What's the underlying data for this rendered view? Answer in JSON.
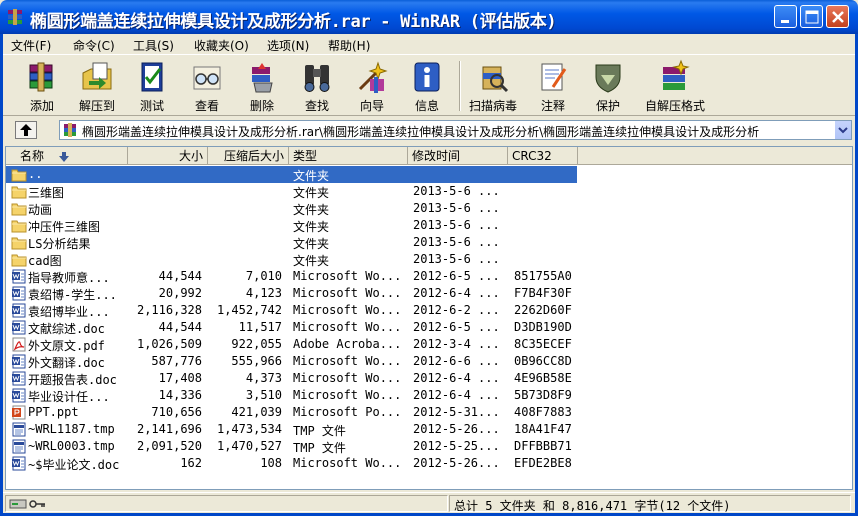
{
  "window": {
    "title": "椭圆形端盖连续拉伸模具设计及成形分析.rar - WinRAR (评估版本)"
  },
  "menu": [
    {
      "label": "文件(F)"
    },
    {
      "label": "命令(C)"
    },
    {
      "label": "工具(S)"
    },
    {
      "label": "收藏夹(O)"
    },
    {
      "label": "选项(N)"
    },
    {
      "label": "帮助(H)"
    }
  ],
  "toolbar": [
    {
      "label": "添加",
      "icon": "add-books-icon"
    },
    {
      "label": "解压到",
      "icon": "extract-to-icon"
    },
    {
      "label": "测试",
      "icon": "test-icon"
    },
    {
      "label": "查看",
      "icon": "view-glasses-icon"
    },
    {
      "label": "删除",
      "icon": "delete-icon"
    },
    {
      "label": "查找",
      "icon": "find-binoculars-icon"
    },
    {
      "label": "向导",
      "icon": "wizard-icon"
    },
    {
      "label": "信息",
      "icon": "info-icon"
    },
    {
      "label": "扫描病毒",
      "icon": "virus-scan-icon"
    },
    {
      "label": "注释",
      "icon": "comment-icon"
    },
    {
      "label": "保护",
      "icon": "protect-shield-icon"
    },
    {
      "label": "自解压格式",
      "icon": "sfx-icon"
    }
  ],
  "address": {
    "path": "椭圆形端盖连续拉伸模具设计及成形分析.rar\\椭圆形端盖连续拉伸模具设计及成形分析\\椭圆形端盖连续拉伸模具设计及成形分析"
  },
  "columns": {
    "name": "名称",
    "size": "大小",
    "packed": "压缩后大小",
    "type": "类型",
    "modified": "修改时间",
    "crc": "CRC32"
  },
  "files": [
    {
      "name": "..",
      "size": "",
      "packed": "",
      "type": "文件夹",
      "modified": "",
      "crc": "",
      "icon": "folder-icon",
      "selected": true
    },
    {
      "name": "三维图",
      "size": "",
      "packed": "",
      "type": "文件夹",
      "modified": "2013-5-6 ...",
      "crc": "",
      "icon": "folder-icon"
    },
    {
      "name": "动画",
      "size": "",
      "packed": "",
      "type": "文件夹",
      "modified": "2013-5-6 ...",
      "crc": "",
      "icon": "folder-icon"
    },
    {
      "name": "冲压件三维图",
      "size": "",
      "packed": "",
      "type": "文件夹",
      "modified": "2013-5-6 ...",
      "crc": "",
      "icon": "folder-icon"
    },
    {
      "name": "LS分析结果",
      "size": "",
      "packed": "",
      "type": "文件夹",
      "modified": "2013-5-6 ...",
      "crc": "",
      "icon": "folder-icon"
    },
    {
      "name": "cad图",
      "size": "",
      "packed": "",
      "type": "文件夹",
      "modified": "2013-5-6 ...",
      "crc": "",
      "icon": "folder-icon"
    },
    {
      "name": "指导教师意...",
      "size": "44,544",
      "packed": "7,010",
      "type": "Microsoft Wo...",
      "modified": "2012-6-5 ...",
      "crc": "851755A0",
      "icon": "word-doc-icon"
    },
    {
      "name": "袁绍博-学生...",
      "size": "20,992",
      "packed": "4,123",
      "type": "Microsoft Wo...",
      "modified": "2012-6-4 ...",
      "crc": "F7B4F30F",
      "icon": "word-doc-icon"
    },
    {
      "name": "袁绍博毕业...",
      "size": "2,116,328",
      "packed": "1,452,742",
      "type": "Microsoft Wo...",
      "modified": "2012-6-2 ...",
      "crc": "2262D60F",
      "icon": "word-doc-icon"
    },
    {
      "name": "文献综述.doc",
      "size": "44,544",
      "packed": "11,517",
      "type": "Microsoft Wo...",
      "modified": "2012-6-5 ...",
      "crc": "D3DB190D",
      "icon": "word-doc-icon"
    },
    {
      "name": "外文原文.pdf",
      "size": "1,026,509",
      "packed": "922,055",
      "type": "Adobe Acroba...",
      "modified": "2012-3-4 ...",
      "crc": "8C35ECEF",
      "icon": "pdf-icon"
    },
    {
      "name": "外文翻译.doc",
      "size": "587,776",
      "packed": "555,966",
      "type": "Microsoft Wo...",
      "modified": "2012-6-6 ...",
      "crc": "0B96CC8D",
      "icon": "word-doc-icon"
    },
    {
      "name": "开题报告表.doc",
      "size": "17,408",
      "packed": "4,373",
      "type": "Microsoft Wo...",
      "modified": "2012-6-4 ...",
      "crc": "4E96B58E",
      "icon": "word-doc-icon"
    },
    {
      "name": "毕业设计任...",
      "size": "14,336",
      "packed": "3,510",
      "type": "Microsoft Wo...",
      "modified": "2012-6-4 ...",
      "crc": "5B73D8F9",
      "icon": "word-doc-icon"
    },
    {
      "name": "PPT.ppt",
      "size": "710,656",
      "packed": "421,039",
      "type": "Microsoft Po...",
      "modified": "2012-5-31...",
      "crc": "408F7883",
      "icon": "ppt-icon"
    },
    {
      "name": "~WRL1187.tmp",
      "size": "2,141,696",
      "packed": "1,473,534",
      "type": "TMP 文件",
      "modified": "2012-5-26...",
      "crc": "18A41F47",
      "icon": "tmp-file-icon"
    },
    {
      "name": "~WRL0003.tmp",
      "size": "2,091,520",
      "packed": "1,470,527",
      "type": "TMP 文件",
      "modified": "2012-5-25...",
      "crc": "DFFBBB71",
      "icon": "tmp-file-icon"
    },
    {
      "name": "~$毕业论文.doc",
      "size": "162",
      "packed": "108",
      "type": "Microsoft Wo...",
      "modified": "2012-5-26...",
      "crc": "EFDE2BE8",
      "icon": "word-doc-icon"
    }
  ],
  "status": {
    "summary": "总计 5 文件夹 和 8,816,471 字节(12 个文件)"
  },
  "colors": {
    "titlebar": "#0058E6",
    "selection": "#316AC5",
    "face": "#ECE9D8"
  }
}
